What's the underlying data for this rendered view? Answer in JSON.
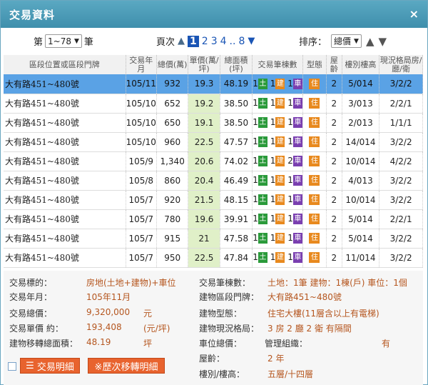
{
  "window": {
    "title": "交易資料",
    "close": "×"
  },
  "pager": {
    "prefix": "第",
    "range": "1~78",
    "suffix": "筆",
    "page_label": "頁次",
    "pages": [
      "1",
      "2",
      "3",
      "4",
      "..",
      "8"
    ],
    "current": "1"
  },
  "sort": {
    "label": "排序：",
    "value": "總價"
  },
  "columns": [
    "區段位置或區段門牌",
    "交易年月",
    "總價(萬)",
    "單價(萬/坪)",
    "總面積(坪)",
    "交易筆棟數",
    "型態",
    "屋齡",
    "樓別樓高",
    "現況格局房/廳/衛"
  ],
  "rows": [
    {
      "addr": "大有路451~480號",
      "ym": "105/11",
      "total": "932",
      "unit": "19.3",
      "area": "48.19",
      "c1": "1",
      "l": "土",
      "c2": "1",
      "b": "建",
      "c3": "1",
      "c": "車",
      "use": "住",
      "age": "2",
      "floor": "5/014",
      "layout": "3/2/2"
    },
    {
      "addr": "大有路451~480號",
      "ym": "105/10",
      "total": "652",
      "unit": "19.2",
      "area": "38.50",
      "c1": "1",
      "l": "土",
      "c2": "1",
      "b": "建",
      "c3": "1",
      "c": "車",
      "use": "住",
      "age": "2",
      "floor": "3/013",
      "layout": "2/2/1"
    },
    {
      "addr": "大有路451~480號",
      "ym": "105/10",
      "total": "650",
      "unit": "19.1",
      "area": "38.50",
      "c1": "1",
      "l": "土",
      "c2": "1",
      "b": "建",
      "c3": "1",
      "c": "車",
      "use": "住",
      "age": "2",
      "floor": "2/013",
      "layout": "1/1/1"
    },
    {
      "addr": "大有路451~480號",
      "ym": "105/10",
      "total": "960",
      "unit": "22.5",
      "area": "47.57",
      "c1": "1",
      "l": "土",
      "c2": "1",
      "b": "建",
      "c3": "1",
      "c": "車",
      "use": "住",
      "age": "2",
      "floor": "14/014",
      "layout": "3/2/2"
    },
    {
      "addr": "大有路451~480號",
      "ym": "105/9",
      "total": "1,340",
      "unit": "20.6",
      "area": "74.02",
      "c1": "1",
      "l": "土",
      "c2": "1",
      "b": "建",
      "c3": "2",
      "c": "車",
      "use": "住",
      "age": "2",
      "floor": "10/014",
      "layout": "4/2/2"
    },
    {
      "addr": "大有路451~480號",
      "ym": "105/8",
      "total": "860",
      "unit": "20.4",
      "area": "46.49",
      "c1": "1",
      "l": "土",
      "c2": "1",
      "b": "建",
      "c3": "1",
      "c": "車",
      "use": "住",
      "age": "2",
      "floor": "4/013",
      "layout": "3/2/2"
    },
    {
      "addr": "大有路451~480號",
      "ym": "105/7",
      "total": "920",
      "unit": "21.5",
      "area": "48.15",
      "c1": "1",
      "l": "土",
      "c2": "1",
      "b": "建",
      "c3": "1",
      "c": "車",
      "use": "住",
      "age": "2",
      "floor": "10/014",
      "layout": "3/2/2"
    },
    {
      "addr": "大有路451~480號",
      "ym": "105/7",
      "total": "780",
      "unit": "19.6",
      "area": "39.91",
      "c1": "1",
      "l": "土",
      "c2": "1",
      "b": "建",
      "c3": "1",
      "c": "車",
      "use": "住",
      "age": "2",
      "floor": "5/014",
      "layout": "2/2/1"
    },
    {
      "addr": "大有路451~480號",
      "ym": "105/7",
      "total": "915",
      "unit": "21",
      "area": "47.58",
      "c1": "1",
      "l": "土",
      "c2": "1",
      "b": "建",
      "c3": "1",
      "c": "車",
      "use": "住",
      "age": "2",
      "floor": "5/014",
      "layout": "3/2/2"
    },
    {
      "addr": "大有路451~480號",
      "ym": "105/7",
      "total": "950",
      "unit": "22.5",
      "area": "47.84",
      "c1": "1",
      "l": "土",
      "c2": "1",
      "b": "建",
      "c3": "1",
      "c": "車",
      "use": "住",
      "age": "2",
      "floor": "11/014",
      "layout": "3/2/2"
    }
  ],
  "detail": {
    "target_label": "交易標的：",
    "target_value": "房地(土地+建物)+車位",
    "ym_label": "交易年月：",
    "ym_value": "105年11月",
    "total_label": "交易總價：",
    "total_value": "9,320,000",
    "total_unit": "元",
    "unit_label": "交易單價 約：",
    "unit_value": "193,408",
    "unit_unit": "(元/坪)",
    "area_label": "建物移轉總面積：",
    "area_value": "48.19",
    "area_unit": "坪",
    "count_label": "交易筆棟數：",
    "count_value": "土地：1筆 建物：1棟(戶) 車位：1個",
    "addr_label": "建物區段門牌：",
    "addr_value": "大有路451~480號",
    "type_label": "建物型態：",
    "type_value": "住宅大樓(11層含以上有電梯)",
    "layout_label": "建物現況格局：",
    "layout_value": "3 房 2 廳 2 衛 有隔間",
    "car_label": "車位總價：",
    "mgmt_label": "管理組織：",
    "mgmt_value": "有",
    "age_label": "屋齡：",
    "age_value": "2 年",
    "floor_label": "樓別/樓高：",
    "floor_value": "五層/十四層"
  },
  "buttons": {
    "detail": "交易明細",
    "history": "※歷次移轉明細"
  }
}
